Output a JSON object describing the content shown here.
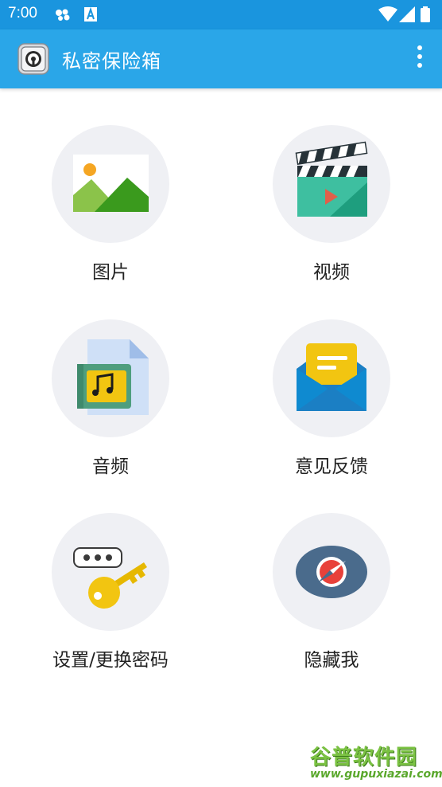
{
  "status_bar": {
    "time": "7:00"
  },
  "app_bar": {
    "title": "私密保险箱",
    "logo_icon": "safe-icon",
    "menu_icon": "more-vert-icon"
  },
  "menu": [
    {
      "id": "pictures",
      "label": "图片",
      "icon": "image-icon"
    },
    {
      "id": "videos",
      "label": "视频",
      "icon": "video-clapper-icon"
    },
    {
      "id": "audio",
      "label": "音频",
      "icon": "music-file-icon"
    },
    {
      "id": "feedback",
      "label": "意见反馈",
      "icon": "envelope-icon"
    },
    {
      "id": "settings",
      "label": "设置/更换密码",
      "icon": "password-key-icon"
    },
    {
      "id": "hide",
      "label": "隐藏我",
      "icon": "compass-icon"
    }
  ],
  "watermark": {
    "title": "谷普软件园",
    "url": "www.gupuxiazai.com"
  },
  "colors": {
    "status_bar": "#1a95de",
    "app_bar": "#2aa6e8",
    "icon_circle": "#eff0f4"
  }
}
